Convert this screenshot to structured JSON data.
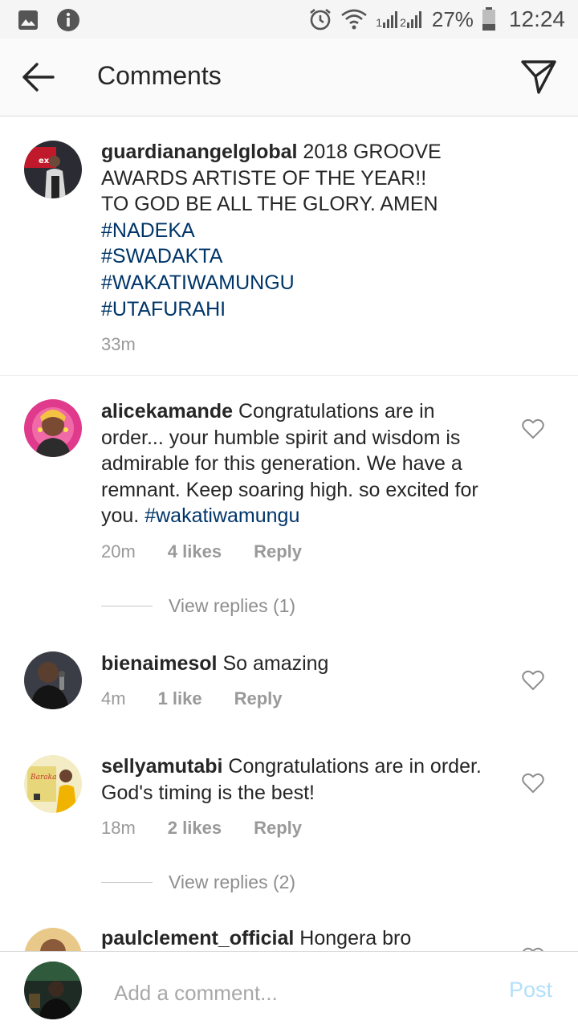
{
  "status_bar": {
    "sim1_label": "1",
    "sim2_label": "2",
    "battery": "27%",
    "time": "12:24",
    "icons": [
      "image-icon",
      "info-icon",
      "alarm-icon",
      "wifi-icon",
      "signal-icon",
      "battery-icon"
    ]
  },
  "header": {
    "title": "Comments",
    "back_icon": "arrow-left-icon",
    "direct_icon": "send-icon"
  },
  "caption": {
    "username": "guardianangelglobal",
    "text_line1": " 2018 GROOVE AWARDS ARTISTE OF THE YEAR!!",
    "text_line2": "TO GOD BE ALL THE GLORY. AMEN",
    "hashtags": [
      "#NADEKA",
      "#SWADAKTA",
      "#WAKATIWAMUNGU",
      "#UTAFURAHI"
    ],
    "time": "33m"
  },
  "comments": [
    {
      "username": "alicekamande",
      "text": " Congratulations are in order... your humble spirit and wisdom is admirable for this generation. We have a remnant. Keep soaring high. so excited for you. ",
      "hashtag": "#wakatiwamungu",
      "time": "20m",
      "likes": "4 likes",
      "reply": "Reply",
      "view_replies": "View replies (1)"
    },
    {
      "username": "bienaimesol",
      "text": " So amazing",
      "time": "4m",
      "likes": "1 like",
      "reply": "Reply"
    },
    {
      "username": "sellyamutabi",
      "text": " Congratulations are in order. God's timing is the best!",
      "time": "18m",
      "likes": "2 likes",
      "reply": "Reply",
      "view_replies": "View replies (2)"
    },
    {
      "username": "paulclement_official",
      "text": " Hongera bro"
    }
  ],
  "comment_bar": {
    "placeholder": "Add a comment...",
    "post_label": "Post"
  },
  "colors": {
    "hashtag": "#003569",
    "meta_gray": "#999999",
    "post_disabled": "#b2dffc"
  }
}
